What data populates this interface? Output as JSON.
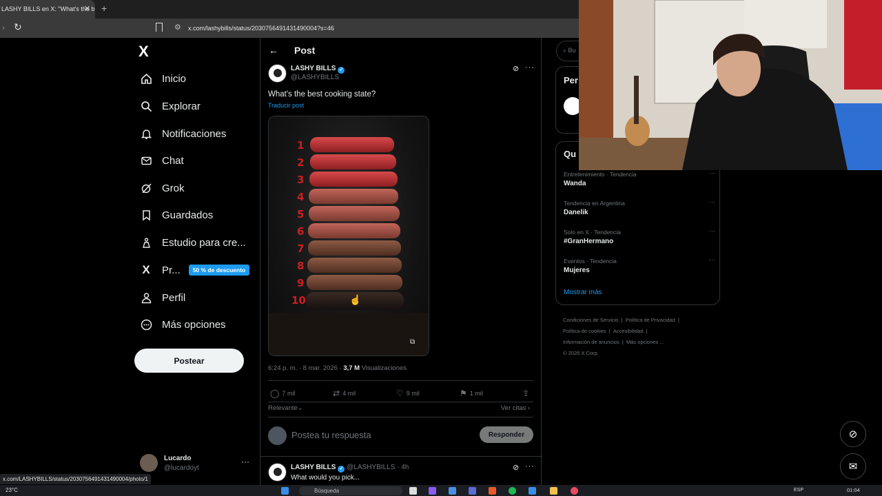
{
  "browser": {
    "tab_title": "LASHY BILLS en X: \"What's the b",
    "url": "x.com/lashybills/status/2030756491431490004?s=46",
    "status_url": "x.com/LASHYBILLS/status/2030756491431490004/photo/1"
  },
  "sidebar": {
    "logo": "X",
    "items": [
      {
        "label": "Inicio",
        "icon": "home-icon"
      },
      {
        "label": "Explorar",
        "icon": "search-icon"
      },
      {
        "label": "Notificaciones",
        "icon": "bell-icon"
      },
      {
        "label": "Chat",
        "icon": "mail-icon"
      },
      {
        "label": "Grok",
        "icon": "grok-icon"
      },
      {
        "label": "Guardados",
        "icon": "bookmark-icon"
      },
      {
        "label": "Estudio para cre...",
        "icon": "creator-studio-icon"
      },
      {
        "label": "Pr...",
        "icon": "x-premium-icon",
        "badge": "50 % de descuento"
      },
      {
        "label": "Perfil",
        "icon": "person-icon"
      },
      {
        "label": "Más opciones",
        "icon": "more-circle-icon"
      }
    ],
    "post_button": "Postear",
    "account": {
      "name": "Lucardo",
      "handle": "@lucardoyt"
    }
  },
  "main": {
    "title": "Post",
    "post": {
      "author": "LASHY BILLS",
      "handle": "@LASHYBILLS",
      "text": "What's the best cooking state?",
      "translate": "Traducir post",
      "image_labels": [
        "1",
        "2",
        "3",
        "4",
        "5",
        "6",
        "7",
        "8",
        "9",
        "10"
      ],
      "time": "6:24 p. m. · 8 mar. 2026 ·",
      "views_count": "3,7 M",
      "views_label": "Visualizaciones",
      "replies": "7 mil",
      "reposts": "4 mil",
      "likes": "9 mil",
      "bookmarks": "1 mil"
    },
    "sort_label": "Relevante",
    "quotes_label": "Ver citas",
    "reply_placeholder": "Postea tu respuesta",
    "reply_button": "Responder",
    "next_reply": {
      "author": "LASHY BILLS",
      "handle": "@LASHYBILLS",
      "time": "· 4h",
      "text": "What would you pick..."
    }
  },
  "right": {
    "search_placeholder": "Bu",
    "box1_title": "Per",
    "trends_title": "Qu",
    "trends": [
      {
        "meta": "Entretenimiento · Tendencia",
        "name": "Wanda"
      },
      {
        "meta": "Tendencia en Argentina",
        "name": "Danelik"
      },
      {
        "meta": "Solo en X · Tendencia",
        "name": "#GranHermano"
      },
      {
        "meta": "Eventos · Tendencia",
        "name": "Mujeres"
      }
    ],
    "show_more": "Mostrar más",
    "footer": [
      "Condiciones de Servicio",
      "Política de Privacidad",
      "Política de cookies",
      "Accesibilidad",
      "Información de anuncios",
      "Más opciones ...",
      "© 2026 X Corp."
    ]
  },
  "taskbar": {
    "temperature": "23°C",
    "search": "Búsqueda",
    "lang": "ESP",
    "time": "01:04"
  },
  "colors": {
    "accent": "#1d9bf0",
    "background": "#000000",
    "border": "#2f3336",
    "muted": "#71767b",
    "steak_red": "#cc1f1f"
  }
}
